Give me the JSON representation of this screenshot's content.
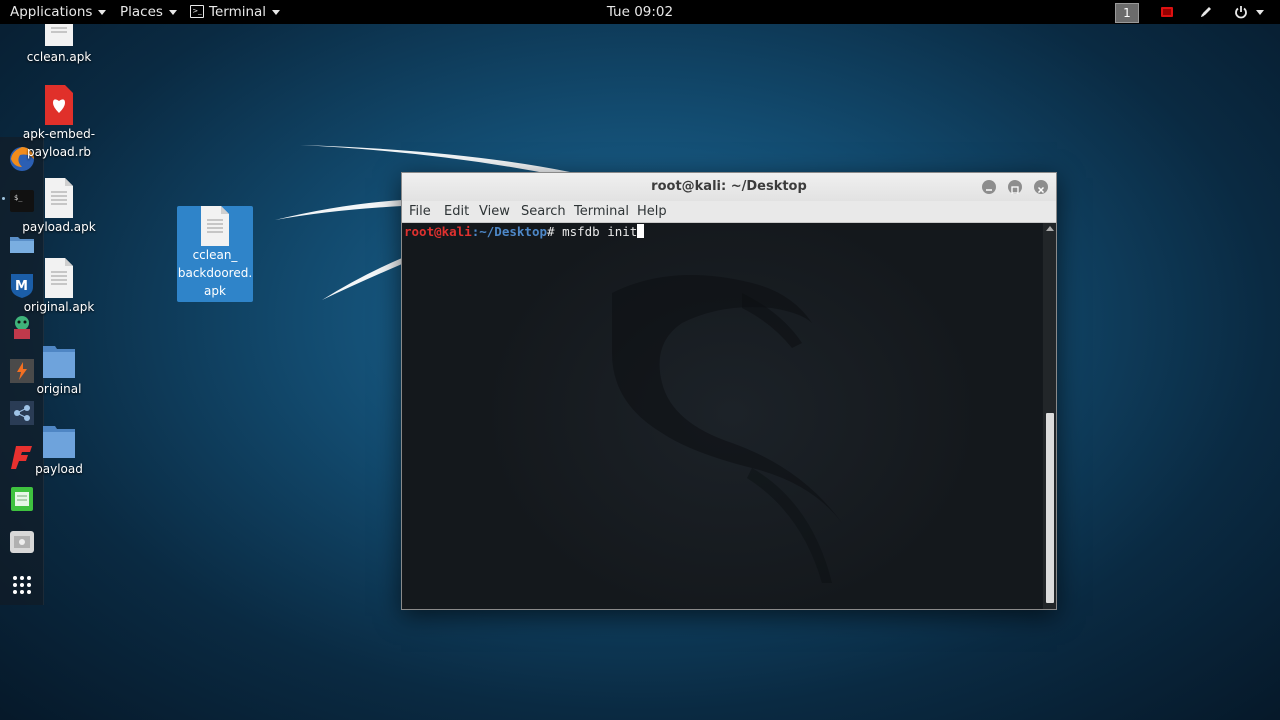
{
  "topbar": {
    "applications_label": "Applications",
    "places_label": "Places",
    "terminal_label": "Terminal",
    "clock": "Tue 09:02",
    "workspace_number": "1"
  },
  "dock": {
    "items": [
      {
        "name": "firefox-icon"
      },
      {
        "name": "terminal-app-icon"
      },
      {
        "name": "files-icon"
      },
      {
        "name": "metasploit-icon"
      },
      {
        "name": "armitage-icon"
      },
      {
        "name": "burpsuite-icon"
      },
      {
        "name": "maltego-icon"
      },
      {
        "name": "faraday-icon"
      },
      {
        "name": "leafpad-icon"
      },
      {
        "name": "screenshot-icon"
      },
      {
        "name": "show-apps-icon"
      }
    ]
  },
  "desktop": {
    "icons": [
      {
        "label": "cclean.apk"
      },
      {
        "label": "apk-embed-payload.rb"
      },
      {
        "label": "payload.apk"
      },
      {
        "label": "original.apk"
      },
      {
        "label": "original"
      },
      {
        "label": "payload"
      }
    ],
    "selected_icon": {
      "line1": "cclean_",
      "line2": "backdoored.",
      "line3": "apk"
    }
  },
  "terminal_window": {
    "title": "root@kali: ~/Desktop",
    "menu": [
      "File",
      "Edit",
      "View",
      "Search",
      "Terminal",
      "Help"
    ],
    "prompt_user": "root@kali",
    "prompt_path": ":~/Desktop",
    "prompt_symbol": "#",
    "command": "msfdb init"
  },
  "colors": {
    "prompt_user": "#e0312f",
    "prompt_path": "#4d87c7",
    "selection": "#2f84c9"
  }
}
